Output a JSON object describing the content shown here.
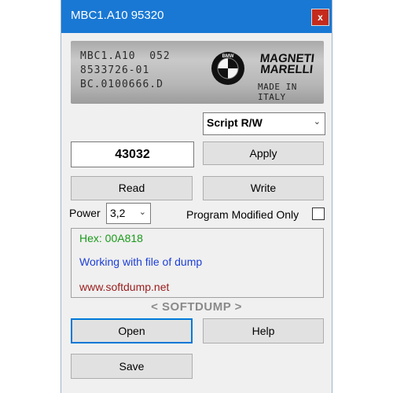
{
  "window": {
    "title": "MBC1.A10 95320",
    "close_label": "x"
  },
  "ecu_label": {
    "lines": [
      "MBC1.A10  052",
      "8533726-01",
      "BC.0100666.D"
    ],
    "brand_top": "MAGNETI",
    "brand_bottom": "MARELLI",
    "origin": "MADE IN ITALY",
    "bmw_letters": "BMW"
  },
  "mode_select": {
    "value": "Script R/W"
  },
  "number_field": {
    "value": "43032"
  },
  "buttons": {
    "apply": "Apply",
    "read": "Read",
    "write": "Write",
    "open": "Open",
    "help": "Help",
    "save": "Save"
  },
  "power": {
    "label": "Power",
    "value": "3,2"
  },
  "program_modified_only": {
    "label": "Program Modified Only",
    "checked": false
  },
  "log": {
    "hex": "Hex: 00A818",
    "status": "Working with file of dump",
    "url": "www.softdump.net"
  },
  "footer": {
    "brand": "< SOFTDUMP >"
  },
  "colors": {
    "title_bar": "#1978d4",
    "close_button": "#c42b1c",
    "hex_text": "#1a9a1a",
    "status_text": "#1d3fd6",
    "url_text": "#9a1c1c",
    "focus_border": "#0078d7"
  }
}
